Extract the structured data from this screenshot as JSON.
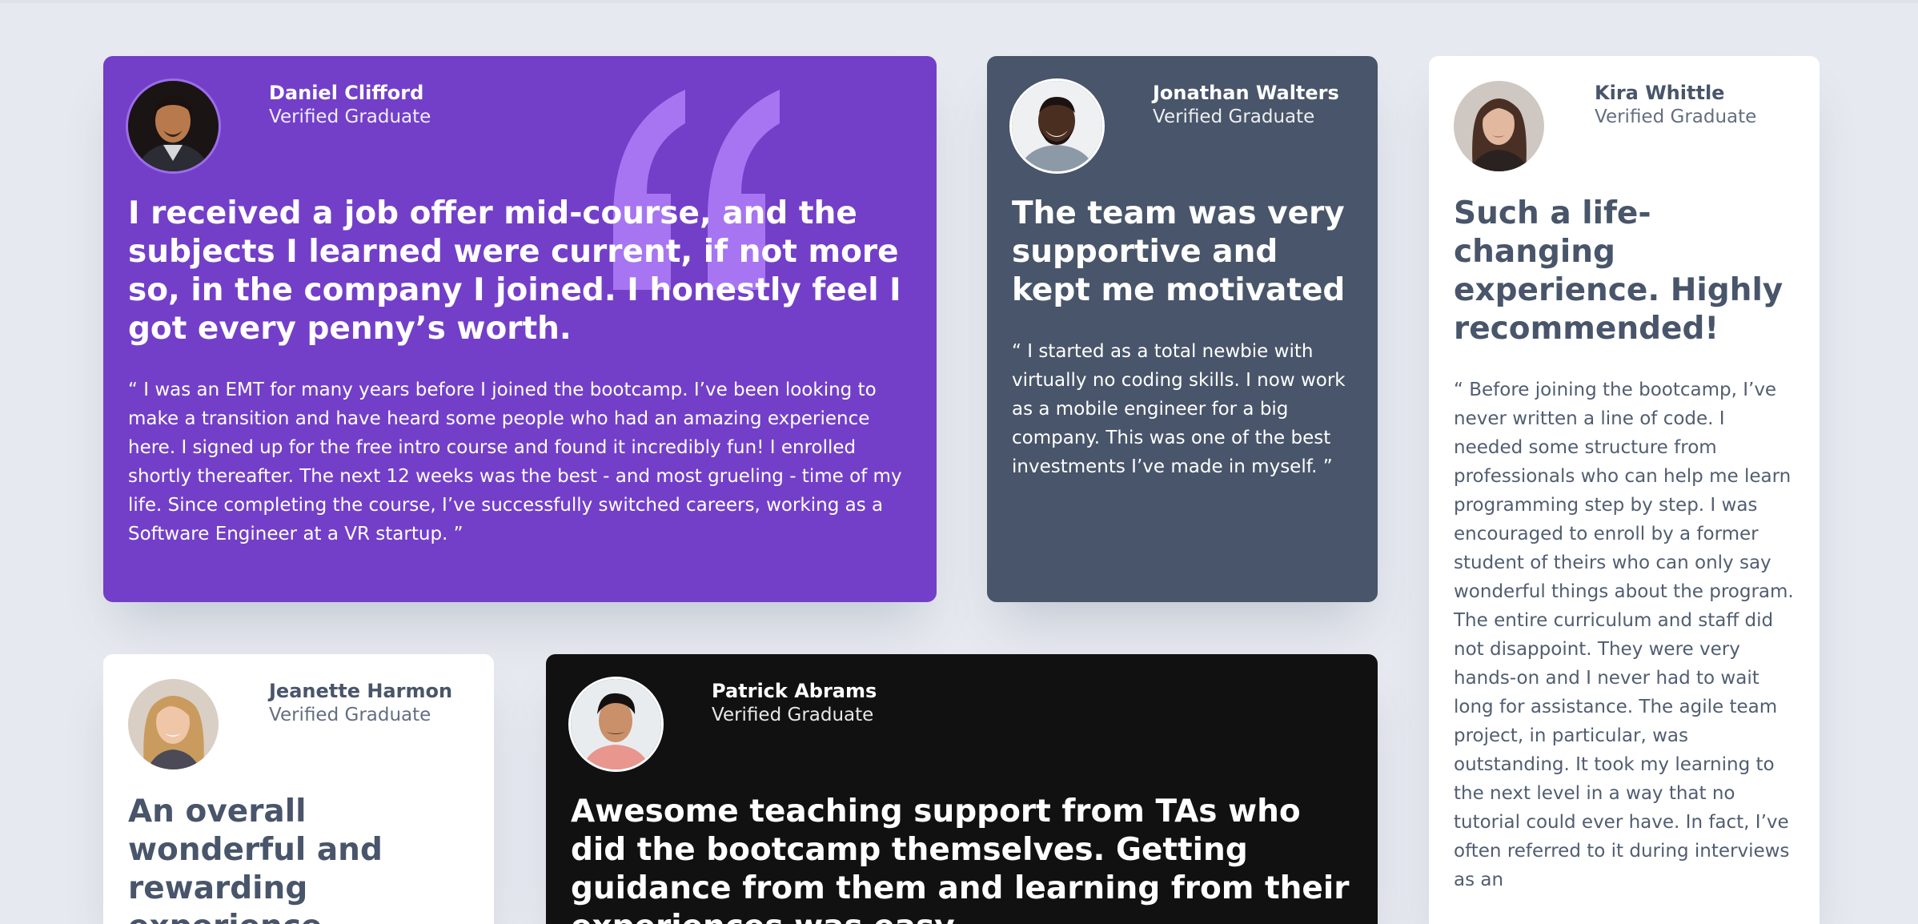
{
  "testimonials": [
    {
      "name": "Daniel Clifford",
      "role": "Verified Graduate",
      "headline": "I received a job offer mid-course, and the subjects I learned were current, if not more so, in the company I joined. I honestly feel I got every penny’s worth.",
      "quote": "“ I was an EMT for many years before I joined the bootcamp. I’ve been looking to make a transition and have heard some people who had an amazing experience here. I signed up for the free intro course and found it incredibly fun! I enrolled shortly thereafter. The next 12 weeks was the best - and most grueling - time of my life. Since completing the course, I’ve successfully switched careers, working as a Software Engineer at a VR startup. ”"
    },
    {
      "name": "Jonathan Walters",
      "role": "Verified Graduate",
      "headline": "The team was very supportive and kept me motivated",
      "quote": "“ I started as a total newbie with virtually no coding skills. I now work as a mobile engineer for a big company. This was one of the best investments I’ve made in myself. ”"
    },
    {
      "name": "Kira Whittle",
      "role": "Verified Graduate",
      "headline": "Such a life-changing experience. Highly recommended!",
      "quote": "“ Before joining the bootcamp, I’ve never written a line of code. I needed some structure from professionals who can help me learn programming step by step. I was encouraged to enroll by a former student of theirs who can only say wonderful things about the program. The entire curriculum and staff did not disappoint. They were very hands-on and I never had to wait long for assistance. The agile team project, in particular, was outstanding. It took my learning to the next level in a way that no tutorial could ever have. In fact, I’ve often referred to it during interviews as an"
    },
    {
      "name": "Jeanette Harmon",
      "role": "Verified Graduate",
      "headline": "An overall wonderful and rewarding experience"
    },
    {
      "name": "Patrick Abrams",
      "role": "Verified Graduate",
      "headline": "Awesome teaching support from TAs who did the bootcamp themselves. Getting guidance from them and learning from their experiences was easy."
    }
  ],
  "colors": {
    "page_bg": "#e6e9ef",
    "violet": "#733fc8",
    "grayish_blue": "#48556a",
    "white": "#ffffff",
    "black": "#111111",
    "quote_mark": "#a775f1"
  },
  "icons": {
    "quotation_mark": "quote-icon"
  }
}
